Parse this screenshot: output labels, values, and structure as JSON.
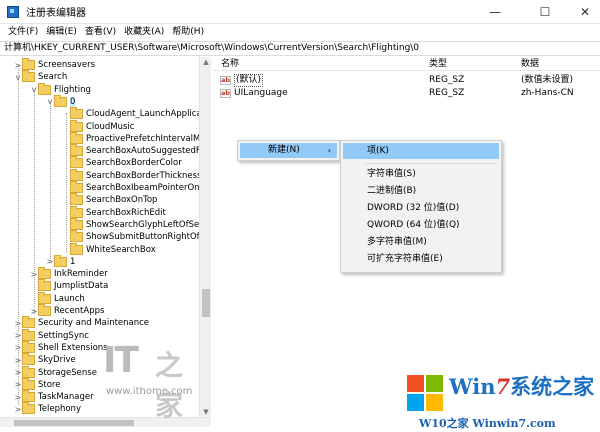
{
  "window": {
    "title": "注册表编辑器",
    "controls": {
      "minimize": "—",
      "maximize": "☐",
      "close": "✕"
    }
  },
  "menu": [
    "文件(F)",
    "编辑(E)",
    "查看(V)",
    "收藏夹(A)",
    "帮助(H)"
  ],
  "address": "计算机\\HKEY_CURRENT_USER\\Software\\Microsoft\\Windows\\CurrentVersion\\Search\\Flighting\\0",
  "tree": {
    "items": [
      {
        "label": "Screensavers",
        "expander": ">"
      },
      {
        "label": "Search",
        "expander": "v"
      },
      {
        "label": "Flighting",
        "expander": "v"
      },
      {
        "label": "0",
        "expander": "v",
        "selected": true
      },
      {
        "label": "CloudAgent_LaunchApplication",
        "expander": ""
      },
      {
        "label": "CloudMusic",
        "expander": ""
      },
      {
        "label": "ProactivePrefetchIntervalMinute",
        "expander": ""
      },
      {
        "label": "SearchBoxAutoSuggestedFore",
        "expander": ""
      },
      {
        "label": "SearchBoxBorderColor",
        "expander": ""
      },
      {
        "label": "SearchBoxBorderThickness",
        "expander": ""
      },
      {
        "label": "SearchBoxIbeamPointerOnHov",
        "expander": ""
      },
      {
        "label": "SearchBoxOnTop",
        "expander": ""
      },
      {
        "label": "SearchBoxRichEdit",
        "expander": ""
      },
      {
        "label": "ShowSearchGlyphLeftOfSearch",
        "expander": ""
      },
      {
        "label": "ShowSubmitButtonRightOfSear",
        "expander": ""
      },
      {
        "label": "WhiteSearchBox",
        "expander": ""
      },
      {
        "label": "1",
        "expander": ">"
      },
      {
        "label": "InkReminder",
        "expander": ">"
      },
      {
        "label": "JumplistData",
        "expander": ""
      },
      {
        "label": "Launch",
        "expander": ""
      },
      {
        "label": "RecentApps",
        "expander": ">"
      },
      {
        "label": "Security and Maintenance",
        "expander": ">"
      },
      {
        "label": "SettingSync",
        "expander": ">"
      },
      {
        "label": "Shell Extensions",
        "expander": ">"
      },
      {
        "label": "SkyDrive",
        "expander": ">"
      },
      {
        "label": "StorageSense",
        "expander": ">"
      },
      {
        "label": "Store",
        "expander": ">"
      },
      {
        "label": "TaskManager",
        "expander": ">"
      },
      {
        "label": "Telephony",
        "expander": ">"
      }
    ]
  },
  "list": {
    "columns": {
      "name": "名称",
      "type": "类型",
      "data": "数据"
    },
    "rows": [
      {
        "icon": "ab",
        "name": "(默认)",
        "type": "REG_SZ",
        "data": "(数值未设置)"
      },
      {
        "icon": "ab",
        "name": "UILanguage",
        "type": "REG_SZ",
        "data": "zh-Hans-CN"
      }
    ]
  },
  "context_menu": {
    "new": {
      "label": "新建(N)",
      "arrow": "›"
    },
    "submenu": [
      "项(K)",
      "字符串值(S)",
      "二进制值(B)",
      "DWORD (32 位)值(D)",
      "QWORD (64 位)值(Q)",
      "多字符串值(M)",
      "可扩充字符串值(E)"
    ]
  },
  "watermarks": {
    "ithome": {
      "logo": "IT",
      "cn": "之家",
      "url": "www.ithome.com"
    },
    "win7": {
      "title_win": "Win",
      "title_seven": "7",
      "title_rest": "系统之家",
      "url": "W10之家 Winwin7.com"
    }
  },
  "colors": {
    "selection": "#cce8ff",
    "menu_highlight": "#91c9f7",
    "folder": "#f3cf63",
    "win7_blue": "#1c6fc2",
    "win7_red": "#e0302a"
  }
}
